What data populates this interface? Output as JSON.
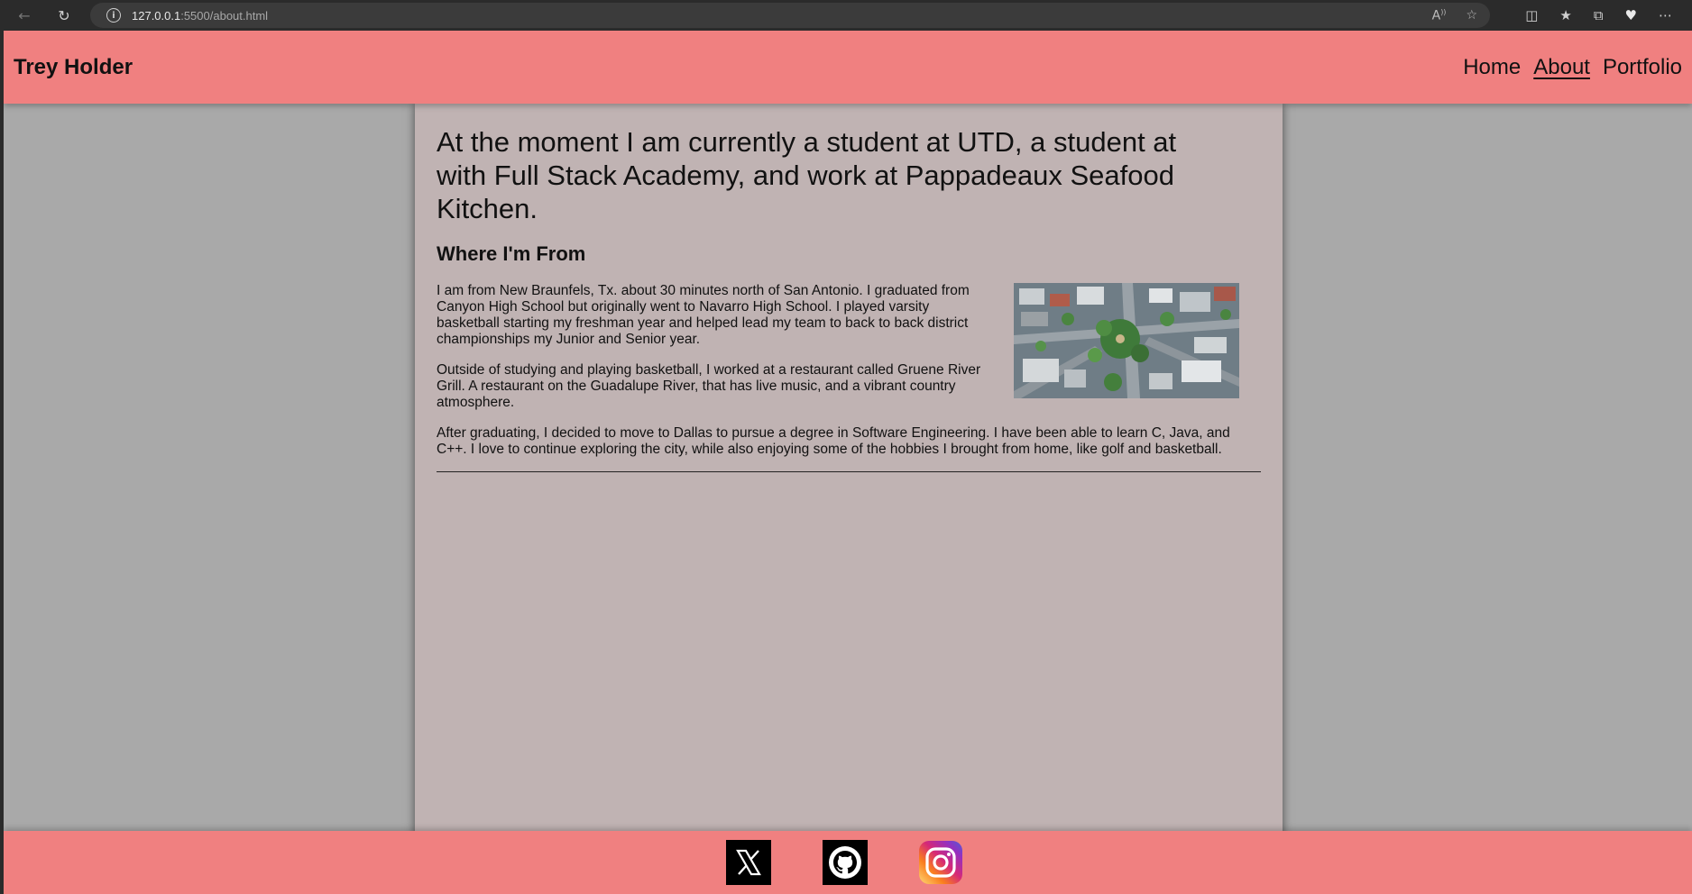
{
  "browser": {
    "url_host": "127.0.0.1",
    "url_rest": ":5500/about.html"
  },
  "header": {
    "brand": "Trey Holder",
    "nav": [
      {
        "label": "Home"
      },
      {
        "label": "About"
      },
      {
        "label": "Portfolio"
      }
    ]
  },
  "main": {
    "lead": "At the moment I am currently a student at UTD, a student at with Full Stack Academy, and work at Pappadeaux Seafood Kitchen.",
    "section_title": "Where I'm From",
    "paragraphs": [
      "I am from New Braunfels, Tx. about 30 minutes north of San Antonio. I graduated from Canyon High School but originally went to Navarro High School. I played varsity basketball starting my freshman year and helped lead my team to back to back district championships my Junior and Senior year.",
      "Outside of studying and playing basketball, I worked at a restaurant called Gruene River Grill. A restaurant on the Guadalupe River, that has live music, and a vibrant country atmosphere.",
      "After graduating, I decided to move to Dallas to pursue a degree in Software Engineering. I have been able to learn C, Java, and C++. I love to continue exploring the city, while also enjoying some of the hobbies I brought from home, like golf and basketball."
    ]
  },
  "footer": {
    "social": [
      {
        "icon": "x-twitter-icon"
      },
      {
        "icon": "github-icon"
      },
      {
        "icon": "instagram-icon"
      }
    ]
  },
  "colors": {
    "header_bg": "#f08080",
    "panel_bg": "#c0b3b3",
    "page_bg": "#a9a9a9"
  }
}
